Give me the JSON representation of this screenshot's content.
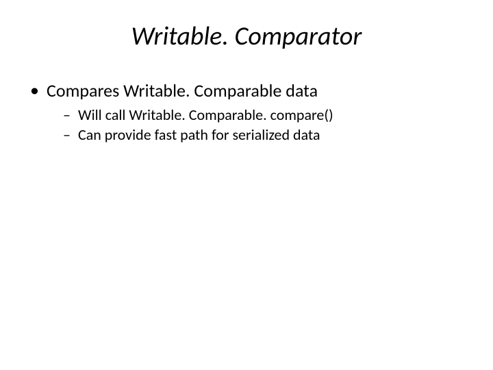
{
  "title": "Writable. Comparator",
  "bullets": [
    {
      "text": "Compares Writable. Comparable data",
      "children": [
        {
          "text": "Will call Writable. Comparable. compare()"
        },
        {
          "text": "Can provide fast path for serialized data"
        }
      ]
    }
  ]
}
